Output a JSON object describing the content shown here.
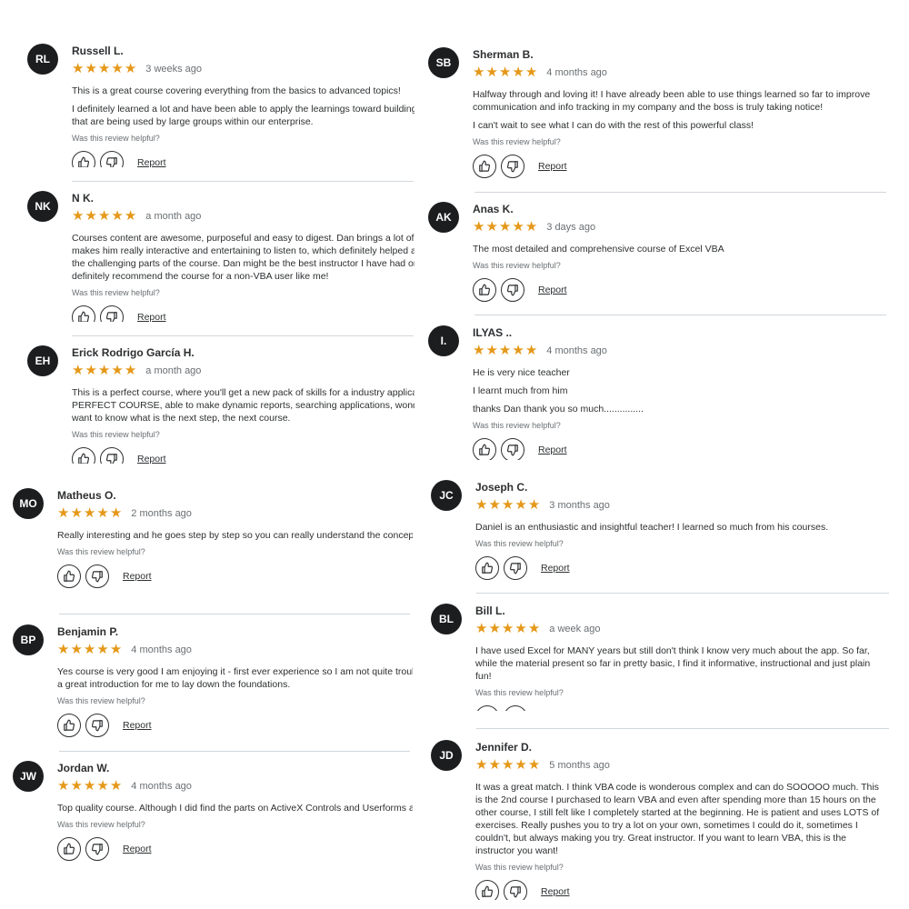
{
  "helpful_prompt": "Was this review helpful?",
  "report_label": "Report",
  "colors": {
    "star": "#e59819",
    "avatar_bg": "#1c1d1f",
    "text": "#2d2f31",
    "muted": "#6a6f73"
  },
  "icons": {
    "star": "star-icon",
    "helpful": "thumbs-up-icon",
    "not_helpful": "thumbs-down-icon"
  },
  "reviews": [
    {
      "initials": "RL",
      "name": "Russell L.",
      "rating": 5,
      "date": "3 weeks ago",
      "paragraphs": [
        "This is a great course covering everything from the basics to advanced topics!",
        "I definitely learned a lot and have been able to apply the learnings toward building complex applications that are being used by large groups within our enterprise."
      ]
    },
    {
      "initials": "NK",
      "name": "N K.",
      "rating": 5,
      "date": "a month ago",
      "paragraphs": [
        "Courses content are awesome, purposeful and easy to digest. Dan brings a lot of positive energy which makes him really interactive and entertaining to listen to, which definitely helped a lot through the some of the challenging parts of the course. Dan might be the best instructor I have had on Udemy yet. I would definitely recommend the course for a non-VBA user like me!"
      ]
    },
    {
      "initials": "EH",
      "name": "Erick Rodrigo García H.",
      "rating": 5,
      "date": "a month ago",
      "paragraphs": [
        "This is a perfect course, where you'll get a new pack of skills for a industry applications, for me was a PERFECT COURSE, able to make dynamic reports, searching applications, wonderful stuff. BUT i really want to know what is the next step, the next course."
      ]
    },
    {
      "initials": "MO",
      "name": "Matheus O.",
      "rating": 5,
      "date": "2 months ago",
      "paragraphs": [
        "Really interesting and he goes step by step so you can really understand the concepts as you go along."
      ]
    },
    {
      "initials": "BP",
      "name": "Benjamin P.",
      "rating": 5,
      "date": "4 months ago",
      "paragraphs": [
        "Yes course is very good I am enjoying it - first ever experience so I am not quite troubleshooting - but this is a great introduction for me to lay down the foundations."
      ]
    },
    {
      "initials": "JW",
      "name": "Jordan W.",
      "rating": 5,
      "date": "4 months ago",
      "paragraphs": [
        "Top quality course. Although I did find the parts on ActiveX Controls and Userforms a bit lacking."
      ]
    },
    {
      "initials": "SB",
      "name": "Sherman B.",
      "rating": 5,
      "date": "4 months ago",
      "paragraphs": [
        "Halfway through and loving it! I have already been able to use things learned so far to improve communication and info tracking in my company and the boss is truly taking notice!",
        "I can't wait to see what I can do with the rest of this powerful class!"
      ]
    },
    {
      "initials": "AK",
      "name": "Anas K.",
      "rating": 5,
      "date": "3 days ago",
      "paragraphs": [
        "The most detailed and comprehensive course of Excel VBA"
      ]
    },
    {
      "initials": "I.",
      "name": "ILYAS ..",
      "rating": 5,
      "date": "4 months ago",
      "paragraphs": [
        "He is very nice teacher",
        "I learnt much from him",
        "thanks Dan thank you so much..............."
      ]
    },
    {
      "initials": "JC",
      "name": "Joseph C.",
      "rating": 5,
      "date": "3 months ago",
      "paragraphs": [
        "Daniel is an enthusiastic and insightful teacher! I learned so much from his courses."
      ]
    },
    {
      "initials": "BL",
      "name": "Bill L.",
      "rating": 5,
      "date": "a week ago",
      "paragraphs": [
        "I have used Excel for MANY years but still don't think I know very much about the app. So far, while the material present so far in pretty basic, I find it informative, instructional and just plain fun!"
      ]
    },
    {
      "initials": "JD",
      "name": "Jennifer D.",
      "rating": 5,
      "date": "5 months ago",
      "paragraphs": [
        "It was a great match. I think VBA code is wonderous complex and can do SOOOOO much. This is the 2nd course I purchased to learn VBA and even after spending more than 15 hours on the other course, I still felt like I completely started at the beginning. He is patient and uses LOTS of exercises. Really pushes you to try a lot on your own, sometimes I could do it, sometimes I couldn't, but always making you try. Great instructor. If you want to learn VBA, this is the instructor you want!"
      ]
    }
  ]
}
